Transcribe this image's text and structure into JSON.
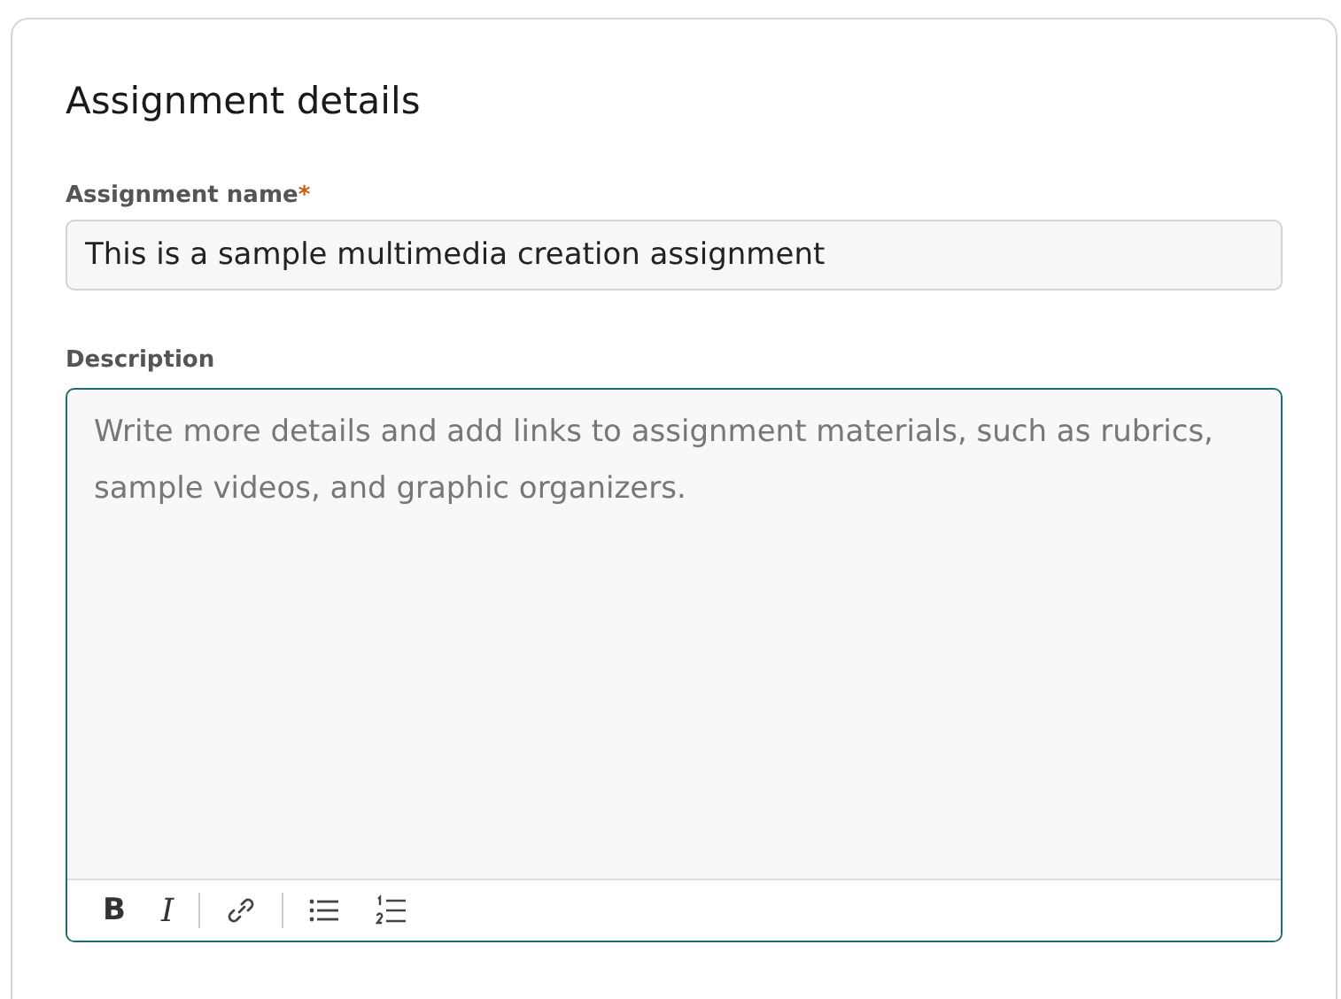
{
  "section": {
    "title": "Assignment details"
  },
  "name_field": {
    "label": "Assignment name",
    "required_mark": "*",
    "value": "This is a sample multimedia creation assignment"
  },
  "description_field": {
    "label": "Description",
    "placeholder": "Write more details and add links to assignment materials, such as rubrics, sample videos, and graphic organizers.",
    "focused": true
  },
  "toolbar": [
    {
      "kind": "bold",
      "label": "B"
    },
    {
      "kind": "italic",
      "label": "I"
    },
    {
      "kind": "divider"
    },
    {
      "kind": "link"
    },
    {
      "kind": "divider"
    },
    {
      "kind": "bullets"
    },
    {
      "kind": "numbers"
    }
  ]
}
